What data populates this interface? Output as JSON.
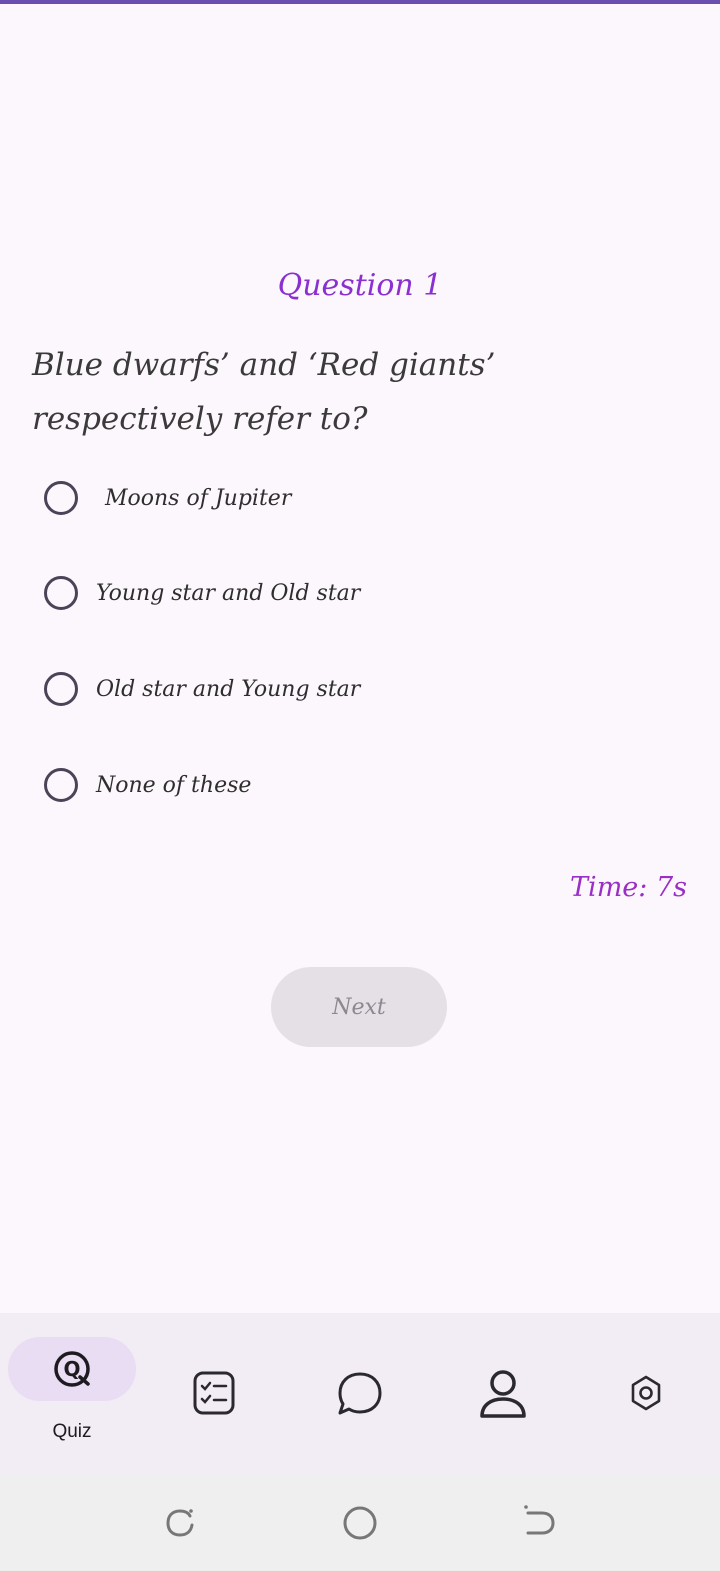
{
  "quiz": {
    "question_title": "Question 1",
    "question_text": "Blue dwarfs’ and ‘Red giants’ respectively refer to?",
    "options": [
      {
        "label": "Moons of Jupiter"
      },
      {
        "label": "Young star and Old star"
      },
      {
        "label": "Old star and Young star"
      },
      {
        "label": "None of these"
      }
    ],
    "timer_label": "Time: ",
    "timer_value": "7s",
    "next_label": "Next"
  },
  "nav": {
    "items": [
      {
        "label": "Quiz",
        "icon": "quiz-icon",
        "active": true
      },
      {
        "label": "",
        "icon": "checklist-icon",
        "active": false
      },
      {
        "label": "",
        "icon": "chat-icon",
        "active": false
      },
      {
        "label": "",
        "icon": "profile-icon",
        "active": false
      },
      {
        "label": "",
        "icon": "settings-icon",
        "active": false
      }
    ]
  },
  "colors": {
    "accent": "#8a2fd0",
    "timer": "#9a2fc6",
    "background": "#fcf7fc",
    "nav_background": "#f2ecf4",
    "active_pill": "#e8ddf3"
  }
}
